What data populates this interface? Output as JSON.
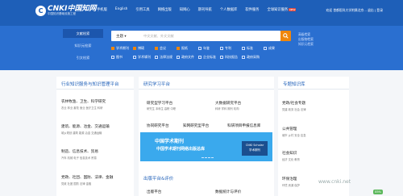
{
  "logo": {
    "mark": "C",
    "name": "CNKI中国知网",
    "slogan": "中国知识基础设施工程"
  },
  "nav": [
    "手机版",
    "English",
    "引用工具",
    "网络出版",
    "知网心",
    "期刊导航",
    "个人数据库",
    "软件服务",
    "全球知识服务",
    "平台"
  ],
  "nav_badge": "NEW",
  "user": "欢迎 首都医科大学附属北京... 退出 | 登录",
  "modes": [
    "文献检索",
    "知识元检索",
    "引文检索"
  ],
  "search": {
    "select": "主题 ▾",
    "placeholder": "中文文献、外文文献"
  },
  "side_links": [
    "高级检索",
    "出版物检索",
    "知识元检索"
  ],
  "categories": [
    {
      "label": "学术期刊",
      "checked": true
    },
    {
      "label": "博硕",
      "checked": true
    },
    {
      "label": "会议",
      "checked": true
    },
    {
      "label": "报纸",
      "checked": true
    },
    {
      "label": "年鉴",
      "checked": false
    },
    {
      "label": "专利",
      "checked": false
    },
    {
      "label": "标准",
      "checked": false
    },
    {
      "label": "成果",
      "checked": false
    },
    {
      "label": "图书",
      "checked": false
    },
    {
      "label": "学术辑刊",
      "checked": false
    },
    {
      "label": "法律法规",
      "checked": false
    },
    {
      "label": "政府文件",
      "checked": false
    },
    {
      "label": "企业标准",
      "checked": false
    },
    {
      "label": "科技报告",
      "checked": false
    },
    {
      "label": "政府采购",
      "checked": false
    }
  ],
  "panels": {
    "left": {
      "title": "行业知识服务与知识管理平台",
      "sections": [
        {
          "name": "农林牧渔、卫生、科学研究",
          "items": "农业 林业 畜牧 渔业 医疗卫生 科研"
        },
        {
          "name": "建筑、能源、冶金、交通运输",
          "items": "城乡规划 建筑 能源 冶金 交通运输"
        },
        {
          "name": "制造、信息技术、贸易",
          "items": "汽车 机械 电子 信息技术 贸易"
        },
        {
          "name": "党政、社团、国防、法律、金融",
          "items": "党政 社团 国防 法律 金融"
        }
      ]
    },
    "middle": {
      "title": "研究学习平台",
      "items": [
        {
          "name": "研究型学习平台",
          "sub": "研究生 本科生 高职 中职"
        },
        {
          "name": "大数据研究平台",
          "sub": "科研 学科 期刊 机构"
        },
        {
          "name": "协同研究平台",
          "sub": ""
        },
        {
          "name": "知网研究型平台",
          "sub": ""
        },
        {
          "name": "科研项目申报信息库",
          "sub": ""
        }
      ],
      "banner": {
        "line1": "中国学术期刊",
        "line2": "中国学术期刊网络出版总库",
        "box1": "CNKI Scholar",
        "box2": "学术期刊"
      },
      "title2": "出版平台&评价",
      "items2": [
        "出版平台",
        "数据统计与评价"
      ]
    },
    "right": {
      "title": "专题知识库",
      "sections": [
        {
          "name": "党政/社会专题",
          "items": "党建 政务 社会 法律"
        },
        {
          "name": "公共管理",
          "items": "城市 乡村 安全 应急"
        },
        {
          "name": "社会知识",
          "items": "经济 文化 教育"
        },
        {
          "name": "环保治理",
          "items": "环境 资源 保护"
        }
      ]
    }
  },
  "watermark": "www.cnki.net",
  "badge_percent": "85%",
  "colors": {
    "topbar": "#1e5fb8",
    "hero": "#2a6fd0",
    "accent": "#f0860b"
  }
}
